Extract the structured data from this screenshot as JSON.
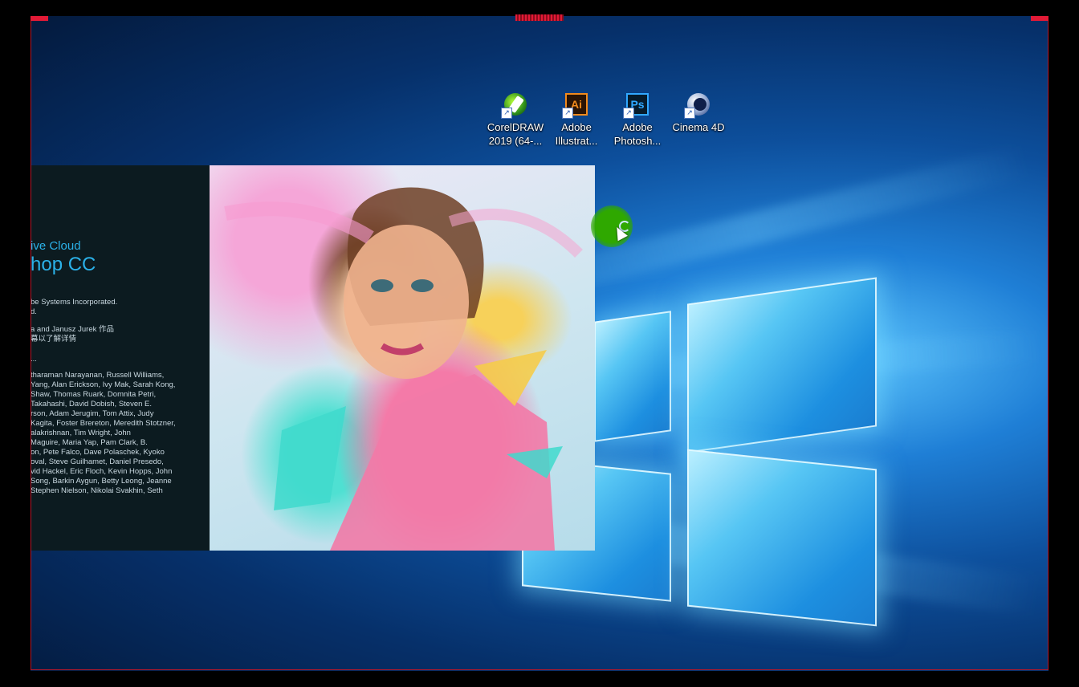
{
  "desktop": {
    "icons": [
      {
        "name": "coreldraw",
        "label": "CorelDRAW\n2019 (64-...",
        "icon": "coreldraw-icon"
      },
      {
        "name": "illustrator",
        "label": "Adobe\nIllustrat...",
        "icon": "illustrator-icon",
        "glyph_text": "Ai"
      },
      {
        "name": "photoshop",
        "label": "Adobe\nPhotosh...",
        "icon": "photoshop-icon",
        "glyph_text": "Ps"
      },
      {
        "name": "cinema4d",
        "label": "Cinema 4D",
        "icon": "cinema4d-icon"
      }
    ]
  },
  "splash": {
    "product_line": "ive Cloud",
    "product_name": "hop CC",
    "copyright": "be Systems Incorporated.",
    "rights": "d.",
    "art_credit": "a and Janusz Jurek 作品",
    "art_more": "幕以了解详情",
    "loading": "...",
    "credits": [
      "tharaman Narayanan, Russell Williams,",
      "Yang, Alan Erickson, Ivy Mak, Sarah Kong,",
      "Shaw, Thomas Ruark, Domnita Petri,",
      "Takahashi, David Dobish, Steven E.",
      "rson, Adam Jerugim, Tom Attix, Judy",
      "Kagita, Foster Brereton, Meredith Stotzner,",
      "alakrishnan, Tim Wright, John",
      "Maguire, Maria Yap, Pam Clark, B.",
      "on, Pete Falco, Dave Polaschek, Kyoko",
      "oval, Steve Guilhamet, Daniel Presedo,",
      "vid Hackel, Eric Floch, Kevin Hopps, John",
      "Song, Barkin Aygun, Betty Leong, Jeanne",
      "Stephen Nielson, Nikolai Svakhin, Seth"
    ]
  },
  "colors": {
    "recording_border": "#b5172b",
    "splash_accent": "#2bb1e8",
    "cursor_highlight": "#2fa800"
  }
}
